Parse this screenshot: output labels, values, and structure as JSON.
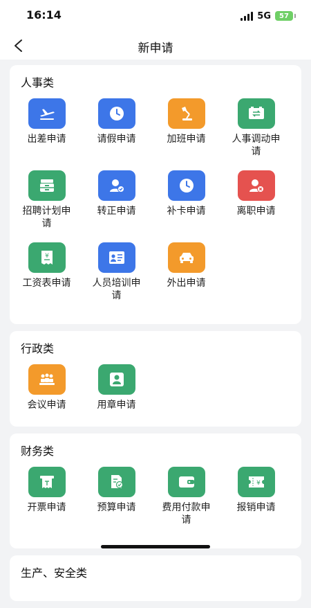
{
  "status_bar": {
    "time": "16:14",
    "network": "5G",
    "battery": "57"
  },
  "nav": {
    "title": "新申请"
  },
  "sections": [
    {
      "title": "人事类",
      "items": [
        {
          "label": "出差申请",
          "icon": "airplane-icon",
          "color": "#3d76e8"
        },
        {
          "label": "请假申请",
          "icon": "clock-icon",
          "color": "#3d76e8"
        },
        {
          "label": "加班申请",
          "icon": "desk-lamp-icon",
          "color": "#f39a2b"
        },
        {
          "label": "人事调动申请",
          "icon": "transfer-icon",
          "color": "#3ba870"
        },
        {
          "label": "招聘计划申请",
          "icon": "drawer-icon",
          "color": "#3ba870"
        },
        {
          "label": "转正申请",
          "icon": "user-check-icon",
          "color": "#3d76e8"
        },
        {
          "label": "补卡申请",
          "icon": "clock-icon",
          "color": "#3d76e8"
        },
        {
          "label": "离职申请",
          "icon": "user-remove-icon",
          "color": "#e5524f"
        },
        {
          "label": "工资表申请",
          "icon": "salary-receipt-icon",
          "color": "#3ba870"
        },
        {
          "label": "人员培训申请",
          "icon": "presentation-icon",
          "color": "#3d76e8"
        },
        {
          "label": "外出申请",
          "icon": "car-icon",
          "color": "#f39a2b"
        }
      ]
    },
    {
      "title": "行政类",
      "items": [
        {
          "label": "会议申请",
          "icon": "meeting-icon",
          "color": "#f39a2b"
        },
        {
          "label": "用章申请",
          "icon": "stamp-icon",
          "color": "#3ba870"
        }
      ]
    },
    {
      "title": "财务类",
      "items": [
        {
          "label": "开票申请",
          "icon": "invoice-icon",
          "color": "#3ba870"
        },
        {
          "label": "预算申请",
          "icon": "budget-icon",
          "color": "#3ba870"
        },
        {
          "label": "费用付款申请",
          "icon": "wallet-icon",
          "color": "#3ba870"
        },
        {
          "label": "报销申请",
          "icon": "reimburse-icon",
          "color": "#3ba870"
        }
      ]
    },
    {
      "title": "生产、安全类",
      "items": []
    }
  ]
}
